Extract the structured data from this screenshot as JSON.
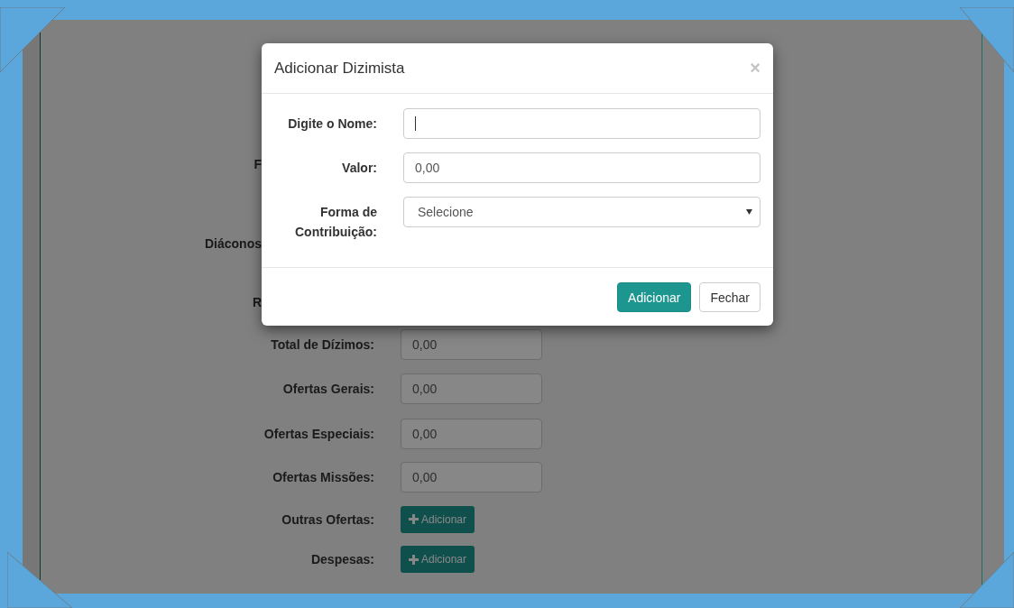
{
  "page": {
    "rows": [
      {
        "label": "F",
        "kind": "partial"
      },
      {
        "label": "Diáconos",
        "kind": "partial"
      },
      {
        "label": "R",
        "kind": "partial"
      },
      {
        "label": "Total de Dízimos:",
        "kind": "field",
        "value": "0,00"
      },
      {
        "label": "Ofertas Gerais:",
        "kind": "field",
        "value": "0,00"
      },
      {
        "label": "Ofertas Especiais:",
        "kind": "field",
        "value": "0,00"
      },
      {
        "label": "Ofertas Missões:",
        "kind": "field",
        "value": "0,00"
      },
      {
        "label": "Outras Ofertas:",
        "kind": "button",
        "button": "Adicionar"
      },
      {
        "label": "Despesas:",
        "kind": "button",
        "button": "Adicionar"
      }
    ]
  },
  "modal": {
    "title": "Adicionar Dizimista",
    "close": "×",
    "fields": [
      {
        "label": "Digite o Nome:",
        "kind": "text",
        "focused": true
      },
      {
        "label": "Valor:",
        "kind": "text",
        "value": "0,00",
        "focused": false
      },
      {
        "label": "Forma de Contribuição:",
        "kind": "select",
        "value": "Selecione",
        "focused": false
      }
    ],
    "buttons": [
      {
        "label": "Adicionar",
        "kind": "primary"
      },
      {
        "label": "Fechar",
        "kind": "default"
      }
    ]
  }
}
